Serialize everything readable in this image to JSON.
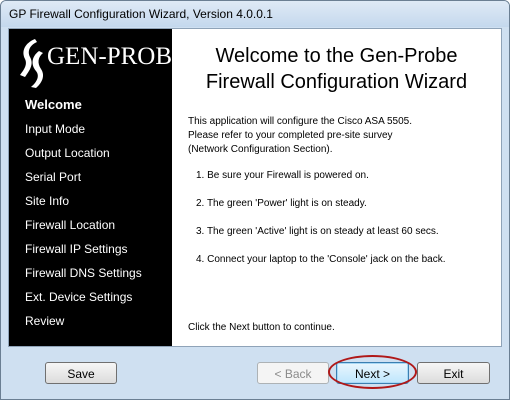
{
  "window": {
    "title": "GP Firewall Configuration Wizard, Version 4.0.0.1"
  },
  "logo": {
    "text": "GEN-PROBE"
  },
  "sidebar": {
    "items": [
      {
        "label": "Welcome",
        "active": true
      },
      {
        "label": "Input Mode",
        "active": false
      },
      {
        "label": "Output Location",
        "active": false
      },
      {
        "label": "Serial Port",
        "active": false
      },
      {
        "label": "Site Info",
        "active": false
      },
      {
        "label": "Firewall Location",
        "active": false
      },
      {
        "label": "Firewall IP Settings",
        "active": false
      },
      {
        "label": "Firewall DNS Settings",
        "active": false
      },
      {
        "label": "Ext. Device Settings",
        "active": false
      },
      {
        "label": "Review",
        "active": false
      }
    ]
  },
  "main": {
    "heading_line1": "Welcome to the Gen-Probe",
    "heading_line2": "Firewall Configuration Wizard",
    "intro_line1": "This application will configure the Cisco ASA 5505.",
    "intro_line2": "Please refer to your completed pre-site survey",
    "intro_line3": "(Network Configuration Section).",
    "steps": [
      "1. Be sure your Firewall is powered on.",
      "2. The green 'Power' light is on steady.",
      "3. The green 'Active' light is on steady at least 60 secs.",
      "4. Connect your laptop to the 'Console' jack on the back."
    ],
    "footer_note": "Click the Next button to continue."
  },
  "buttons": {
    "save": "Save",
    "back": "< Back",
    "next": "Next >",
    "exit": "Exit"
  },
  "colors": {
    "sidebar_bg": "#000000",
    "window_frame": "#cfe0f1",
    "highlight_circle": "#b01818"
  }
}
